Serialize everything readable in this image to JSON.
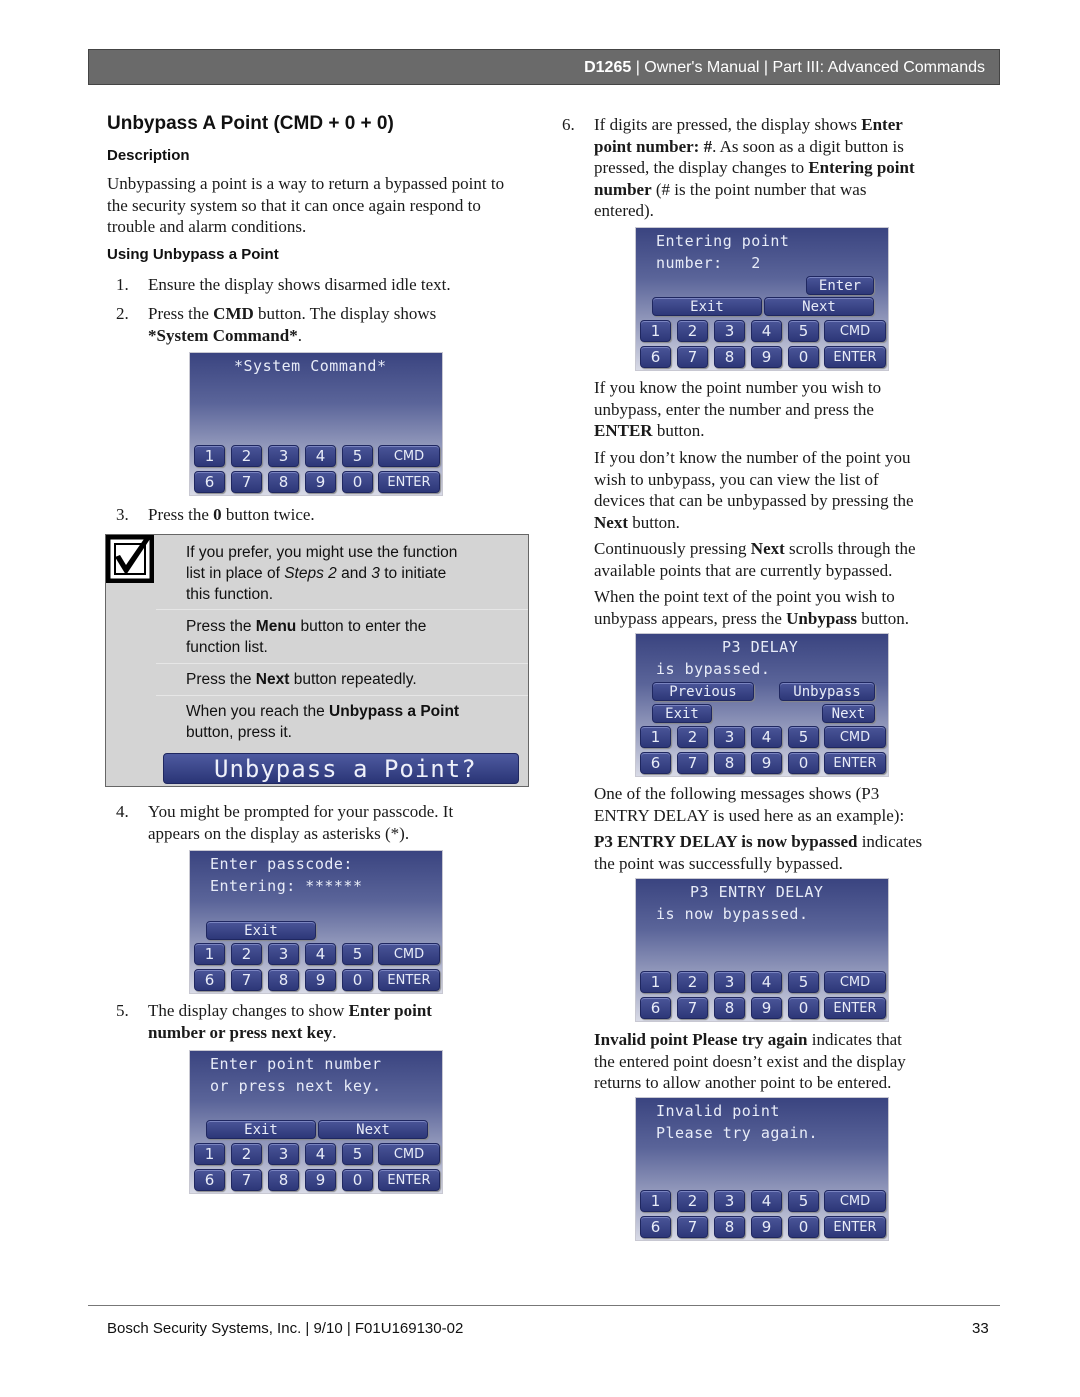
{
  "header": {
    "model": "D1265",
    "rest": " | Owner's Manual | Part III: Advanced Commands"
  },
  "title": "Unbypass A Point (CMD + 0 + 0)",
  "description_heading": "Description",
  "description": "Unbypassing a point is a way to return a bypassed point to the security system so that it can once again respond to trouble and alarm conditions.",
  "using_heading": "Using Unbypass a Point",
  "steps": {
    "s1": {
      "num": "1.",
      "text": "Ensure the display shows disarmed idle text."
    },
    "s2": {
      "num": "2.",
      "pre": "Press the ",
      "b1": "CMD",
      "mid": " button. The display shows",
      "b2": "*System Command*",
      "post": "."
    },
    "s3": {
      "num": "3.",
      "pre": "Press the ",
      "b1": "0",
      "post": " button twice."
    },
    "s4": {
      "num": "4.",
      "line1": "You might be prompted for your passcode. It",
      "line2": "appears on the display as asterisks (*)."
    },
    "s5": {
      "num": "5.",
      "pre": "The display changes to show ",
      "b1": "Enter point",
      "b2": "number or press next key",
      "post": "."
    },
    "s6": {
      "num": "6.",
      "l1pre": "If digits are pressed, the display shows ",
      "l1b": "Enter",
      "l2b": "point number: #",
      "l2post": ". As soon as a digit button is",
      "l3pre": "pressed, the display changes to ",
      "l3b": "Entering point",
      "l4b": "number",
      "l4post": " (# is the point number that was",
      "l5": "entered)."
    }
  },
  "note": {
    "p1a": "If you prefer, you might use the function",
    "p1b_pre": "list in place of ",
    "p1b_i1": "Steps 2",
    "p1b_mid": " and ",
    "p1b_i2": "3",
    "p1b_post": " to initiate",
    "p1c": "this function.",
    "p2_pre": "Press the ",
    "p2_b": "Menu",
    "p2_post": " button to enter the",
    "p2b": "function list.",
    "p3_pre": "Press the ",
    "p3_b": "Next",
    "p3_post": " button repeatedly.",
    "p4_pre": "When you reach the ",
    "p4_b": "Unbypass a Point",
    "p4b": "button, press it.",
    "button": "Unbypass a Point?"
  },
  "keypad": {
    "digits_row1": [
      "1",
      "2",
      "3",
      "4",
      "5"
    ],
    "digits_row2": [
      "6",
      "7",
      "8",
      "9",
      "0"
    ],
    "cmd": "CMD",
    "enter": "ENTER"
  },
  "displays": {
    "system_command": {
      "line1": "*System Command*"
    },
    "passcode": {
      "line1": "Enter passcode:",
      "line2": "Entering: ******",
      "exit": "Exit"
    },
    "enter_point": {
      "line1": "Enter point number",
      "line2": "or press next key.",
      "exit": "Exit",
      "next": "Next"
    },
    "entering_point": {
      "line1": "Entering point",
      "line2": "number:   2",
      "enter": "Enter",
      "exit": "Exit",
      "next": "Next"
    },
    "bypassed": {
      "line1": "P3 DELAY",
      "line2": "is bypassed.",
      "previous": "Previous",
      "unbypass": "Unbypass",
      "exit": "Exit",
      "next": "Next"
    },
    "now_bypassed": {
      "line1": "P3 ENTRY DELAY",
      "line2": "is now bypassed."
    },
    "invalid": {
      "line1": "Invalid point",
      "line2": "Please try again."
    }
  },
  "right": {
    "p1_l1": "If you know the point number you wish to",
    "p1_l2": "unbypass, enter the number and press the",
    "p1_b": "ENTER",
    "p1_post": " button.",
    "p2_l1": "If you don’t know the number of the point you",
    "p2_l2": "wish to unbypass, you can view the list of",
    "p2_l3": "devices that can be unbypassed by pressing the",
    "p2_b": "Next",
    "p2_post": " button.",
    "p3_pre": "Continuously pressing ",
    "p3_b": "Next",
    "p3_post": " scrolls through the",
    "p3_l2": "available points that are currently bypassed.",
    "p4_l1": "When the point text of the point you wish to",
    "p4_pre": "unbypass appears, press the ",
    "p4_b": "Unbypass",
    "p4_post": " button.",
    "p5_l1": "One of the following messages shows (P3",
    "p5_l2": "ENTRY DELAY is used here as an example):",
    "p6_b": "P3 ENTRY DELAY is now bypassed",
    "p6_post": " indicates",
    "p6_l2": "the point was successfully bypassed.",
    "p7_b": "Invalid point Please try again",
    "p7_post": " indicates that",
    "p7_l2": "the entered point doesn’t exist and the display",
    "p7_l3": "returns to allow another point to be entered."
  },
  "footer": {
    "left": "Bosch Security Systems, Inc. | 9/10 | F01U169130-02",
    "page": "33"
  }
}
